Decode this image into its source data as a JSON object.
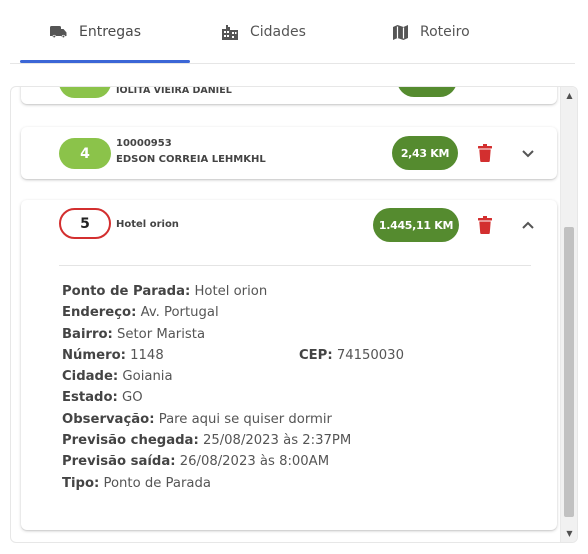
{
  "tabs": [
    {
      "label": "Entregas",
      "icon": "truck-icon",
      "active": true
    },
    {
      "label": "Cidades",
      "icon": "city-icon",
      "active": false
    },
    {
      "label": "Roteiro",
      "icon": "map-icon",
      "active": false
    }
  ],
  "colors": {
    "accent": "#3b66d6",
    "number_pill": "#8bc34a",
    "km_pill": "#558b2f",
    "delete": "#d32f2f"
  },
  "cards": {
    "top": {
      "name": "IOLITA VIEIRA DANIEL"
    },
    "c4": {
      "number": "4",
      "code": "10000953",
      "name": "EDSON CORREIA LEHMKHL",
      "distance": "2,43 KM"
    },
    "c5": {
      "number": "5",
      "name": "Hotel orion",
      "distance": "1.445,11 KM"
    }
  },
  "details": {
    "ponto_label": "Ponto de Parada:",
    "ponto_value": "Hotel orion",
    "endereco_label": "Endereço:",
    "endereco_value": "Av. Portugal",
    "bairro_label": "Bairro:",
    "bairro_value": "Setor Marista",
    "numero_label": "Número:",
    "numero_value": "1148",
    "cep_label": "CEP:",
    "cep_value": "74150030",
    "cidade_label": "Cidade:",
    "cidade_value": "Goiania",
    "estado_label": "Estado:",
    "estado_value": "GO",
    "obs_label": "Observação:",
    "obs_value": "Pare aqui se quiser dormir",
    "chegada_label": "Previsão chegada:",
    "chegada_value": "25/08/2023 às 2:37PM",
    "saida_label": "Previsão saída:",
    "saida_value": "26/08/2023 às 8:00AM",
    "tipo_label": "Tipo:",
    "tipo_value": "Ponto de Parada"
  }
}
